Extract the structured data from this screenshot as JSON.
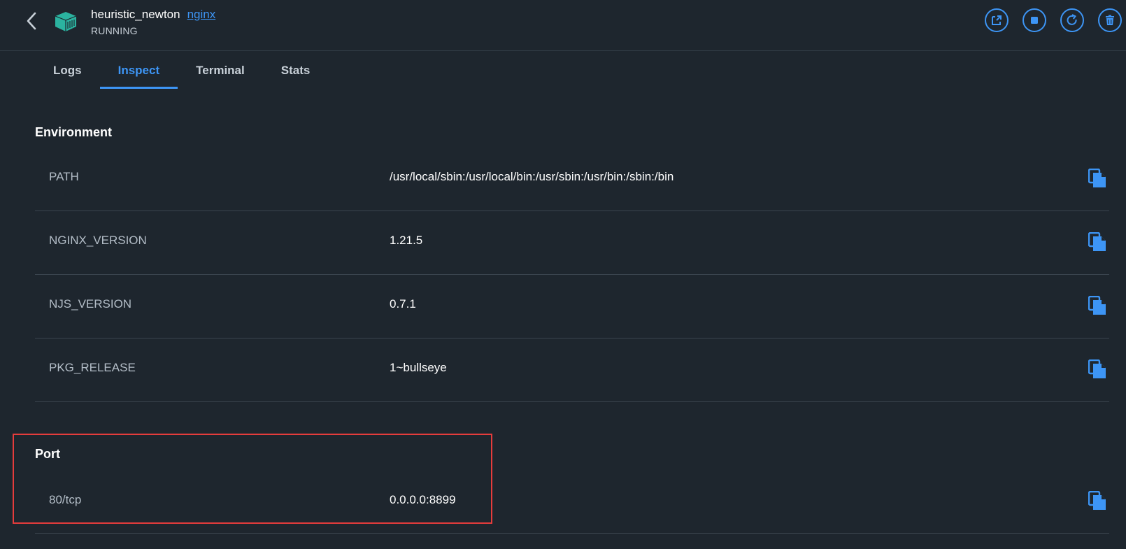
{
  "header": {
    "container_name": "heuristic_newton",
    "image_link": "nginx",
    "status": "RUNNING",
    "actions": [
      {
        "name": "open-in-browser-icon"
      },
      {
        "name": "stop-icon"
      },
      {
        "name": "restart-icon"
      },
      {
        "name": "delete-icon"
      }
    ]
  },
  "tabs": [
    {
      "label": "Logs",
      "active": false
    },
    {
      "label": "Inspect",
      "active": true
    },
    {
      "label": "Terminal",
      "active": false
    },
    {
      "label": "Stats",
      "active": false
    }
  ],
  "environment": {
    "title": "Environment",
    "rows": [
      {
        "key": "PATH",
        "value": "/usr/local/sbin:/usr/local/bin:/usr/sbin:/usr/bin:/sbin:/bin"
      },
      {
        "key": "NGINX_VERSION",
        "value": "1.21.5"
      },
      {
        "key": "NJS_VERSION",
        "value": "0.7.1"
      },
      {
        "key": "PKG_RELEASE",
        "value": "1~bullseye"
      }
    ]
  },
  "port": {
    "title": "Port",
    "rows": [
      {
        "key": "80/tcp",
        "value": "0.0.0.0:8899"
      }
    ]
  },
  "colors": {
    "background": "#1e262e",
    "accent": "#3d95f5",
    "highlight": "#e53c3c",
    "container_icon": "#2bb3a0"
  }
}
